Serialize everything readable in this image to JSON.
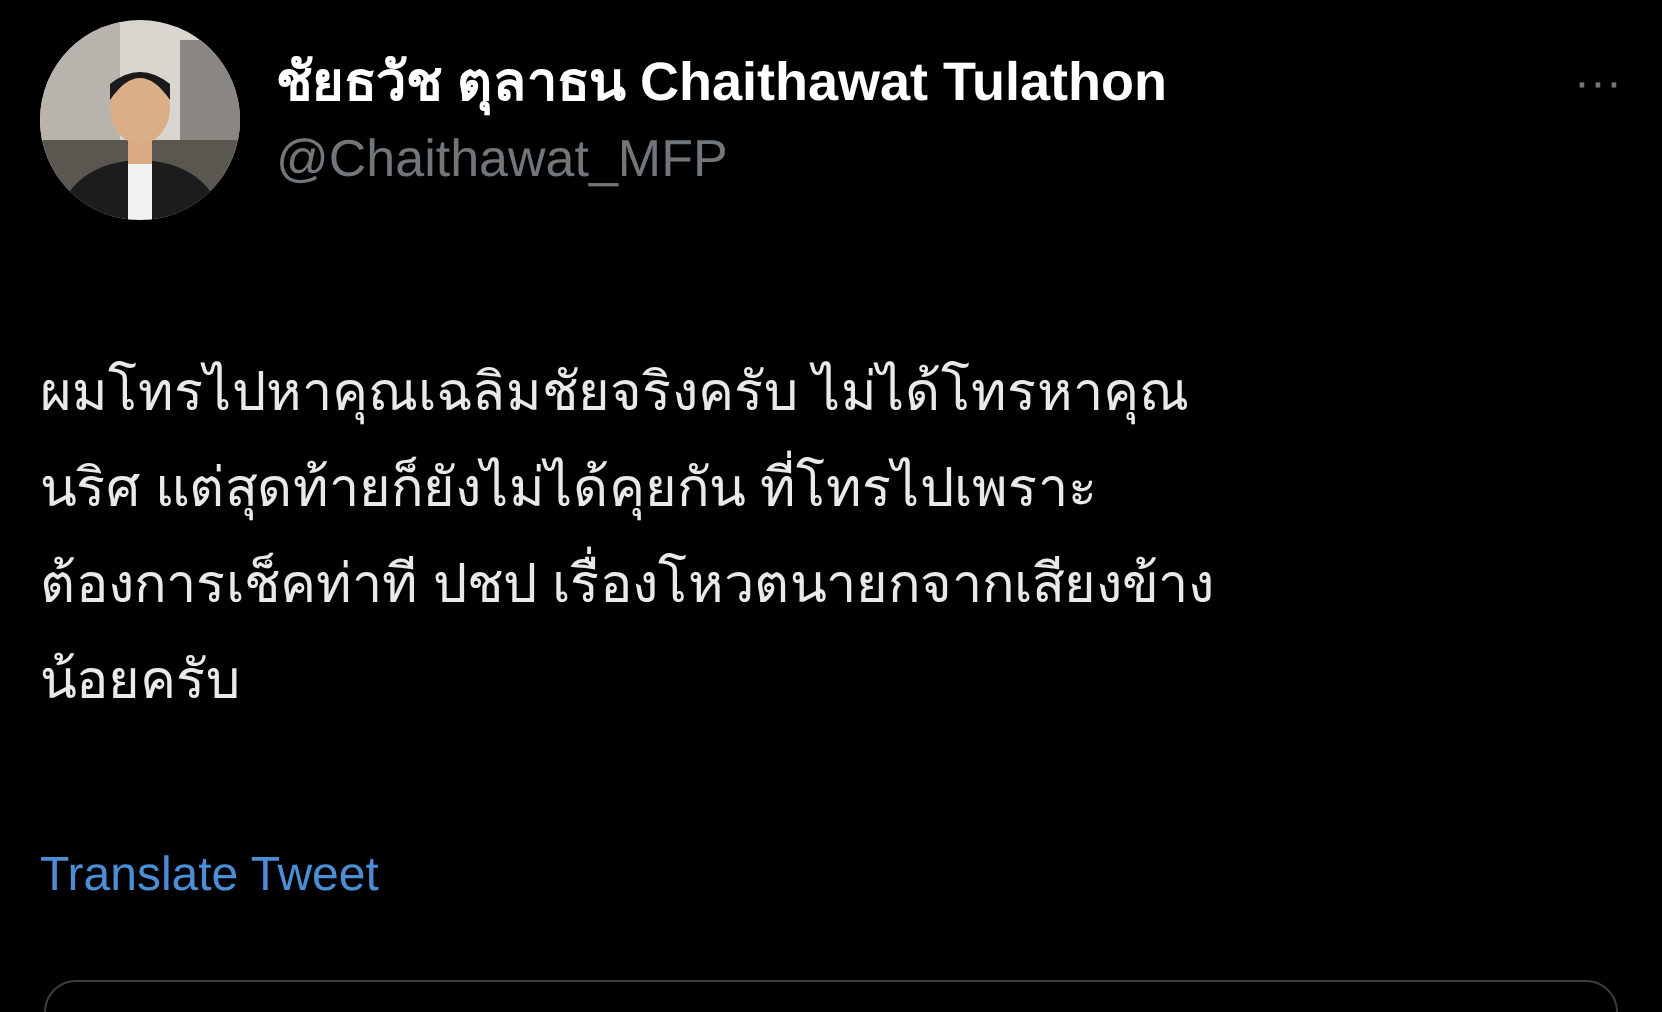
{
  "tweet": {
    "author": {
      "name": "ชัยธวัช ตุลาธน Chaithawat Tulathon",
      "handle": "@Chaithawat_MFP"
    },
    "more": "···",
    "text": "ผมโทรไปหาคุณเฉลิมชัยจริงครับ ไม่ได้โทรหาคุณ\nนริศ  แต่สุดท้ายก็ยังไม่ได้คุยกัน ที่โทรไปเพราะ\nต้องการเช็คท่าที ปชป เรื่องโหวตนายกจากเสียงข้าง\nน้อยครับ",
    "translate": "Translate Tweet"
  }
}
